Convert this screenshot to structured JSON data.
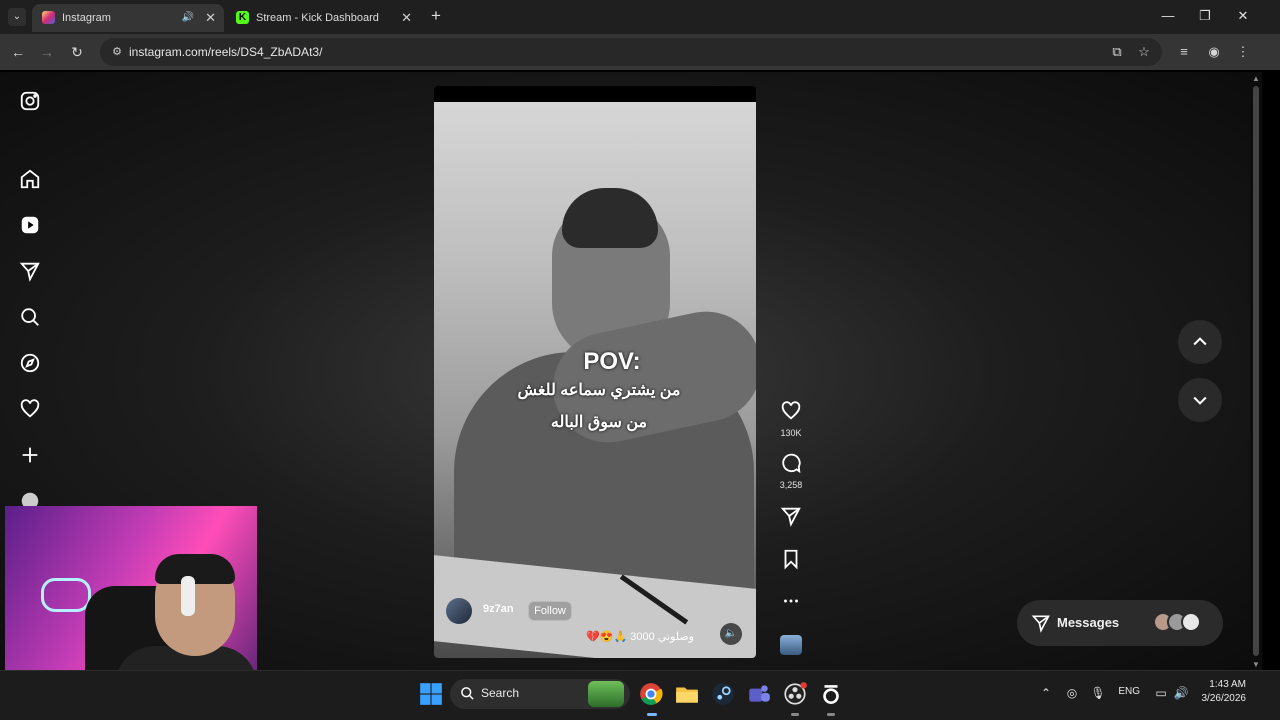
{
  "browser": {
    "tabs": [
      {
        "title": "Instagram",
        "active": true
      },
      {
        "title": "Stream - Kick Dashboard",
        "active": false
      }
    ],
    "url": "instagram.com/reels/DS4_ZbADAt3/"
  },
  "sidebar": {
    "items": [
      "instagram-logo",
      "home",
      "reels",
      "messages",
      "search",
      "explore",
      "notifications",
      "create",
      "profile"
    ]
  },
  "reel": {
    "caption_title": "POV:",
    "caption_line1": "من يشتري سماعه للغش",
    "caption_line2": "من سوق الباله",
    "username": "9z7an",
    "follow_label": "Follow",
    "description": "وصلوني 3000 🙏😍💔"
  },
  "actions": {
    "likes": "130K",
    "comments": "3,258"
  },
  "messages": {
    "label": "Messages"
  },
  "taskbar": {
    "search_label": "Search",
    "lang": "ENG",
    "time": "1:43 AM",
    "date": "3/26/2026"
  },
  "colors": {
    "kick_green": "#53fc18",
    "instagram_gradient": "#dd2a7b",
    "windows_blue": "#3aa0ff"
  }
}
